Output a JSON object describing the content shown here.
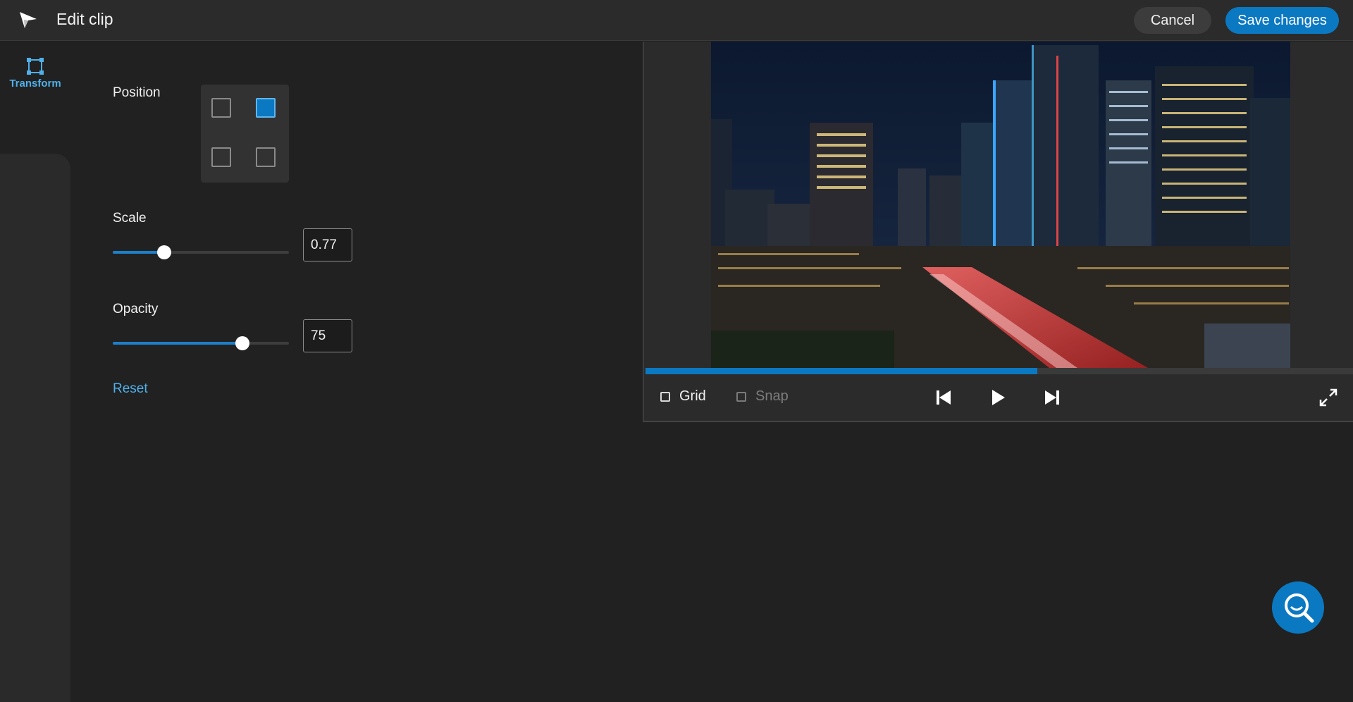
{
  "header": {
    "title": "Edit clip",
    "cancel_label": "Cancel",
    "save_label": "Save changes"
  },
  "rail": {
    "tabs": [
      {
        "label": "Transform",
        "icon": "transform-icon",
        "active": true
      }
    ]
  },
  "transform": {
    "position_label": "Position",
    "position_grid": [
      "top-left",
      "top-right",
      "bottom-left",
      "bottom-right"
    ],
    "position_selected": "top-right",
    "scale_label": "Scale",
    "scale_value": "0.77",
    "scale_fraction": 0.29,
    "opacity_label": "Opacity",
    "opacity_value": "75",
    "opacity_fraction": 0.735,
    "reset_label": "Reset"
  },
  "preview": {
    "progress_fraction": 0.553,
    "grid_label": "Grid",
    "grid_checked": false,
    "snap_label": "Snap",
    "snap_checked": false,
    "snap_disabled": true
  },
  "colors": {
    "accent": "#0b78c2",
    "link": "#4fb0ea",
    "background": "#212121",
    "header": "#2b2b2b"
  }
}
